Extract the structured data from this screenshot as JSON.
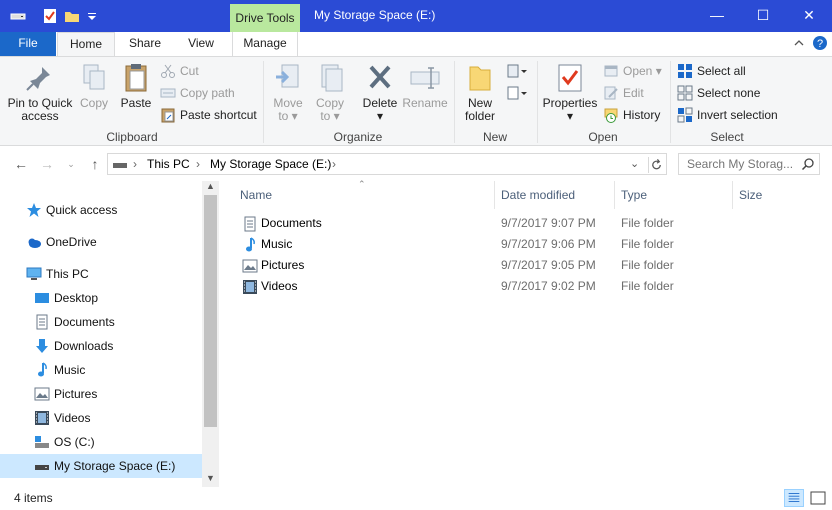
{
  "window": {
    "title": "My Storage Space (E:)",
    "context_tab": "Drive Tools",
    "minimize": "—",
    "maximize": "☐",
    "close": "✕"
  },
  "tabs": {
    "file": "File",
    "home": "Home",
    "share": "Share",
    "view": "View",
    "manage": "Manage"
  },
  "ribbon": {
    "clipboard": {
      "label": "Clipboard",
      "pin": "Pin to Quick access",
      "copy": "Copy",
      "paste": "Paste",
      "cut": "Cut",
      "copy_path": "Copy path",
      "paste_shortcut": "Paste shortcut"
    },
    "organize": {
      "label": "Organize",
      "move_to": "Move to",
      "copy_to": "Copy to",
      "delete": "Delete",
      "rename": "Rename"
    },
    "new": {
      "label": "New",
      "new_folder": "New folder"
    },
    "open": {
      "label": "Open",
      "properties": "Properties",
      "open": "Open",
      "edit": "Edit",
      "history": "History"
    },
    "select": {
      "label": "Select",
      "select_all": "Select all",
      "select_none": "Select none",
      "invert_selection": "Invert selection"
    }
  },
  "address": {
    "crumbs": [
      "This PC",
      "My Storage Space (E:)"
    ],
    "search_placeholder": "Search My Storag..."
  },
  "nav": {
    "quick_access": "Quick access",
    "onedrive": "OneDrive",
    "this_pc": "This PC",
    "desktop": "Desktop",
    "documents": "Documents",
    "downloads": "Downloads",
    "music": "Music",
    "pictures": "Pictures",
    "videos": "Videos",
    "os_c": "OS (C:)",
    "storage_e": "My Storage Space (E:)"
  },
  "columns": {
    "name": "Name",
    "date_modified": "Date modified",
    "type": "Type",
    "size": "Size"
  },
  "files": [
    {
      "name": "Documents",
      "date": "9/7/2017 9:07 PM",
      "type": "File folder",
      "icon": "documents-folder-icon"
    },
    {
      "name": "Music",
      "date": "9/7/2017 9:06 PM",
      "type": "File folder",
      "icon": "music-folder-icon"
    },
    {
      "name": "Pictures",
      "date": "9/7/2017 9:05 PM",
      "type": "File folder",
      "icon": "pictures-folder-icon"
    },
    {
      "name": "Videos",
      "date": "9/7/2017 9:02 PM",
      "type": "File folder",
      "icon": "videos-folder-icon"
    }
  ],
  "status": {
    "count": "4 items"
  },
  "colors": {
    "titlebar": "#2b4bd5",
    "file_tab": "#1b68c9",
    "drive_tools": "#b9e89e",
    "nav_selected": "#cce8ff"
  }
}
